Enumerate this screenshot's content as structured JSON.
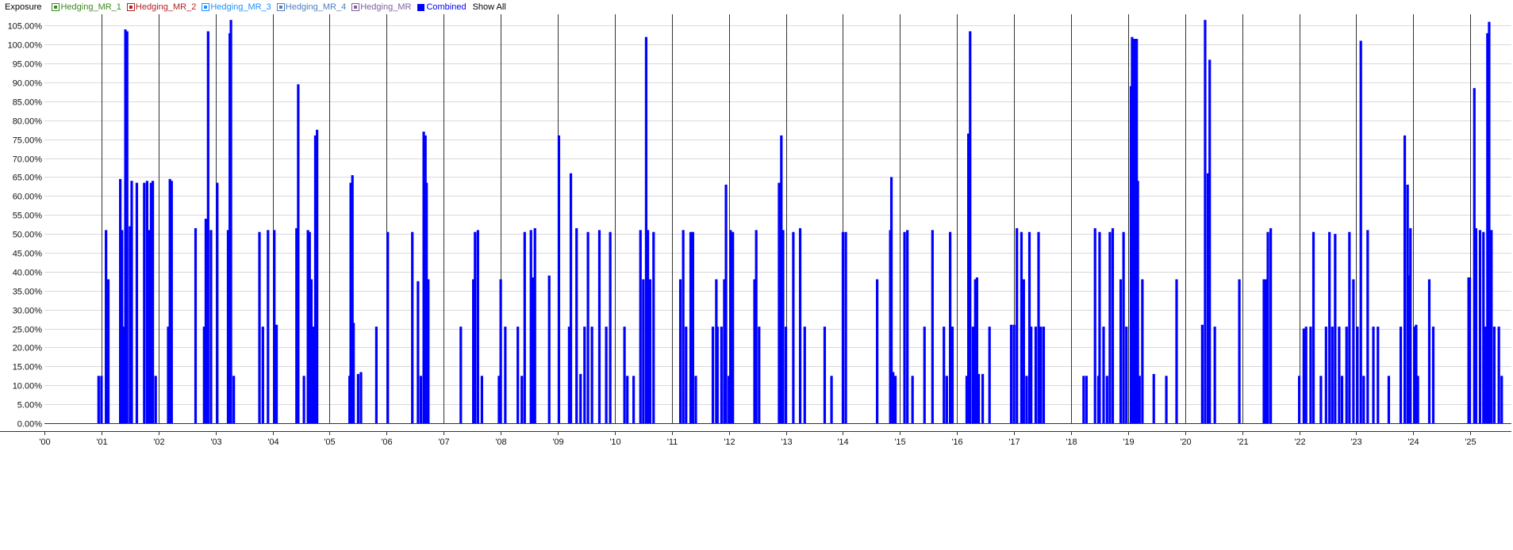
{
  "legend": {
    "title": "Exposure",
    "items": [
      {
        "label": "Hedging_MR_1",
        "color": "#3a8a1f",
        "icon": "checkbox-icon"
      },
      {
        "label": "Hedging_MR_2",
        "color": "#b22222",
        "icon": "checkbox-icon"
      },
      {
        "label": "Hedging_MR_3",
        "color": "#1e90ff",
        "icon": "checkbox-icon"
      },
      {
        "label": "Hedging_MR_4",
        "color": "#4f7fbf",
        "icon": "checkbox-icon"
      },
      {
        "label": "Hedging_MR",
        "color": "#8060a0",
        "icon": "checkbox-icon"
      },
      {
        "label": "Combined",
        "color": "#0000ff",
        "icon": "checkbox-icon",
        "filled": true
      }
    ],
    "show_all": "Show All"
  },
  "chart_data": {
    "type": "bar",
    "series": [
      {
        "name": "Combined",
        "color": "#0000ff"
      }
    ],
    "y_ticks": [
      "0.00%",
      "5.00%",
      "10.00%",
      "15.00%",
      "20.00%",
      "25.00%",
      "30.00%",
      "35.00%",
      "40.00%",
      "45.00%",
      "50.00%",
      "55.00%",
      "60.00%",
      "65.00%",
      "70.00%",
      "75.00%",
      "80.00%",
      "85.00%",
      "90.00%",
      "95.00%",
      "100.00%",
      "105.00%"
    ],
    "x_ticks": [
      "'00",
      "'01",
      "'02",
      "'03",
      "'04",
      "'05",
      "'06",
      "'07",
      "'08",
      "'09",
      "'10",
      "'11",
      "'12",
      "'13",
      "'14",
      "'15",
      "'16",
      "'17",
      "'18",
      "'19",
      "'20",
      "'21",
      "'22",
      "'23",
      "'24",
      "'25"
    ],
    "ylim": [
      0,
      108
    ],
    "xlim": [
      2000.0,
      2025.72
    ],
    "grid": true,
    "bars": [
      [
        2000.95,
        12.5
      ],
      [
        2001.0,
        12.5
      ],
      [
        2001.08,
        51
      ],
      [
        2001.12,
        38
      ],
      [
        2001.33,
        64.5
      ],
      [
        2001.36,
        51
      ],
      [
        2001.4,
        25.5
      ],
      [
        2001.42,
        104
      ],
      [
        2001.45,
        103.5
      ],
      [
        2001.5,
        52
      ],
      [
        2001.53,
        64
      ],
      [
        2001.62,
        63.5
      ],
      [
        2001.75,
        63.5
      ],
      [
        2001.8,
        64
      ],
      [
        2001.83,
        51
      ],
      [
        2001.87,
        63.5
      ],
      [
        2001.9,
        64
      ],
      [
        2001.95,
        12.5
      ],
      [
        2002.17,
        25.5
      ],
      [
        2002.2,
        64.5
      ],
      [
        2002.23,
        64
      ],
      [
        2002.65,
        51.5
      ],
      [
        2002.8,
        25.5
      ],
      [
        2002.83,
        54
      ],
      [
        2002.87,
        103.5
      ],
      [
        2002.92,
        51
      ],
      [
        2003.03,
        63.5
      ],
      [
        2003.22,
        51
      ],
      [
        2003.25,
        103
      ],
      [
        2003.27,
        106.5
      ],
      [
        2003.32,
        12.5
      ],
      [
        2003.77,
        50.5
      ],
      [
        2003.83,
        25.5
      ],
      [
        2003.92,
        51
      ],
      [
        2004.03,
        51
      ],
      [
        2004.07,
        26
      ],
      [
        2004.42,
        51.5
      ],
      [
        2004.45,
        89.5
      ],
      [
        2004.55,
        12.5
      ],
      [
        2004.62,
        51
      ],
      [
        2004.65,
        50.5
      ],
      [
        2004.68,
        38
      ],
      [
        2004.72,
        25.5
      ],
      [
        2004.75,
        76
      ],
      [
        2004.78,
        77.5
      ],
      [
        2005.35,
        12.5
      ],
      [
        2005.37,
        63.5
      ],
      [
        2005.4,
        65.5
      ],
      [
        2005.42,
        26.5
      ],
      [
        2005.5,
        13
      ],
      [
        2005.55,
        13.5
      ],
      [
        2005.82,
        25.5
      ],
      [
        2006.02,
        50.5
      ],
      [
        2006.45,
        50.5
      ],
      [
        2006.55,
        37.5
      ],
      [
        2006.6,
        12.5
      ],
      [
        2006.65,
        77
      ],
      [
        2006.68,
        76
      ],
      [
        2006.7,
        63.5
      ],
      [
        2006.73,
        38
      ],
      [
        2007.3,
        25.5
      ],
      [
        2007.52,
        38
      ],
      [
        2007.55,
        50.5
      ],
      [
        2007.6,
        51
      ],
      [
        2007.67,
        12.5
      ],
      [
        2007.97,
        12.5
      ],
      [
        2008.0,
        38
      ],
      [
        2008.08,
        25.5
      ],
      [
        2008.3,
        25.5
      ],
      [
        2008.37,
        12.5
      ],
      [
        2008.42,
        50.5
      ],
      [
        2008.53,
        51
      ],
      [
        2008.57,
        38.5
      ],
      [
        2008.6,
        51.5
      ],
      [
        2008.85,
        39
      ],
      [
        2009.02,
        76
      ],
      [
        2009.2,
        25.5
      ],
      [
        2009.23,
        66
      ],
      [
        2009.33,
        51.5
      ],
      [
        2009.4,
        13
      ],
      [
        2009.47,
        25.5
      ],
      [
        2009.53,
        50.5
      ],
      [
        2009.6,
        25.5
      ],
      [
        2009.73,
        51
      ],
      [
        2009.85,
        25.5
      ],
      [
        2009.92,
        50.5
      ],
      [
        2010.17,
        25.5
      ],
      [
        2010.22,
        12.5
      ],
      [
        2010.33,
        12.5
      ],
      [
        2010.45,
        51
      ],
      [
        2010.5,
        38
      ],
      [
        2010.55,
        102
      ],
      [
        2010.58,
        51
      ],
      [
        2010.62,
        38
      ],
      [
        2010.68,
        50.5
      ],
      [
        2011.15,
        38
      ],
      [
        2011.2,
        51
      ],
      [
        2011.25,
        25.5
      ],
      [
        2011.33,
        50.5
      ],
      [
        2011.37,
        50.5
      ],
      [
        2011.42,
        12.5
      ],
      [
        2011.72,
        25.5
      ],
      [
        2011.78,
        38
      ],
      [
        2011.8,
        25.5
      ],
      [
        2011.87,
        25.5
      ],
      [
        2011.92,
        38
      ],
      [
        2011.95,
        63
      ],
      [
        2012.0,
        12.5
      ],
      [
        2012.03,
        51
      ],
      [
        2012.07,
        50.5
      ],
      [
        2012.45,
        38
      ],
      [
        2012.48,
        51
      ],
      [
        2012.53,
        25.5
      ],
      [
        2012.88,
        63.5
      ],
      [
        2012.92,
        76
      ],
      [
        2012.95,
        51
      ],
      [
        2013.0,
        25.5
      ],
      [
        2013.13,
        50.5
      ],
      [
        2013.25,
        51.5
      ],
      [
        2013.33,
        25.5
      ],
      [
        2013.68,
        25.5
      ],
      [
        2013.8,
        12.5
      ],
      [
        2014.0,
        50.5
      ],
      [
        2014.05,
        50.5
      ],
      [
        2014.6,
        38
      ],
      [
        2014.83,
        51
      ],
      [
        2014.85,
        65
      ],
      [
        2014.88,
        13.5
      ],
      [
        2014.92,
        12.5
      ],
      [
        2015.08,
        50.5
      ],
      [
        2015.13,
        51
      ],
      [
        2015.22,
        12.5
      ],
      [
        2015.43,
        25.5
      ],
      [
        2015.57,
        51
      ],
      [
        2015.77,
        25.5
      ],
      [
        2015.82,
        12.5
      ],
      [
        2015.88,
        50.5
      ],
      [
        2015.92,
        25.5
      ],
      [
        2016.17,
        12.5
      ],
      [
        2016.2,
        76.5
      ],
      [
        2016.23,
        103.5
      ],
      [
        2016.28,
        25.5
      ],
      [
        2016.32,
        38
      ],
      [
        2016.35,
        38.5
      ],
      [
        2016.38,
        13
      ],
      [
        2016.45,
        13
      ],
      [
        2016.57,
        25.5
      ],
      [
        2016.95,
        26
      ],
      [
        2017.0,
        26
      ],
      [
        2017.05,
        51.5
      ],
      [
        2017.13,
        50.5
      ],
      [
        2017.17,
        38
      ],
      [
        2017.22,
        12.5
      ],
      [
        2017.27,
        50.5
      ],
      [
        2017.3,
        25.5
      ],
      [
        2017.38,
        25.5
      ],
      [
        2017.43,
        50.5
      ],
      [
        2017.47,
        25.5
      ],
      [
        2017.52,
        25.5
      ],
      [
        2018.22,
        12.5
      ],
      [
        2018.27,
        12.5
      ],
      [
        2018.42,
        51.5
      ],
      [
        2018.48,
        12.5
      ],
      [
        2018.5,
        50.5
      ],
      [
        2018.57,
        25.5
      ],
      [
        2018.63,
        12.5
      ],
      [
        2018.68,
        50.5
      ],
      [
        2018.73,
        51.5
      ],
      [
        2018.87,
        38
      ],
      [
        2018.92,
        50.5
      ],
      [
        2018.97,
        25.5
      ],
      [
        2019.05,
        89
      ],
      [
        2019.07,
        102
      ],
      [
        2019.1,
        101.5
      ],
      [
        2019.13,
        101.5
      ],
      [
        2019.15,
        101.5
      ],
      [
        2019.17,
        64
      ],
      [
        2019.2,
        12.5
      ],
      [
        2019.25,
        38
      ],
      [
        2019.45,
        13
      ],
      [
        2019.67,
        12.5
      ],
      [
        2019.85,
        38
      ],
      [
        2020.3,
        26
      ],
      [
        2020.35,
        106.5
      ],
      [
        2020.4,
        66
      ],
      [
        2020.43,
        96
      ],
      [
        2020.52,
        25.5
      ],
      [
        2020.95,
        38
      ],
      [
        2021.38,
        38
      ],
      [
        2021.42,
        38
      ],
      [
        2021.45,
        50.5
      ],
      [
        2021.5,
        51.5
      ],
      [
        2022.0,
        12.5
      ],
      [
        2022.08,
        25
      ],
      [
        2022.12,
        25.5
      ],
      [
        2022.2,
        25.5
      ],
      [
        2022.25,
        50.5
      ],
      [
        2022.38,
        12.5
      ],
      [
        2022.47,
        25.5
      ],
      [
        2022.53,
        50.5
      ],
      [
        2022.58,
        25.5
      ],
      [
        2022.63,
        50
      ],
      [
        2022.7,
        25.5
      ],
      [
        2022.75,
        12.5
      ],
      [
        2022.83,
        25.5
      ],
      [
        2022.88,
        50.5
      ],
      [
        2022.95,
        38
      ],
      [
        2023.02,
        25.5
      ],
      [
        2023.08,
        101
      ],
      [
        2023.13,
        12.5
      ],
      [
        2023.2,
        51
      ],
      [
        2023.3,
        25.5
      ],
      [
        2023.38,
        25.5
      ],
      [
        2023.57,
        12.5
      ],
      [
        2023.78,
        25.5
      ],
      [
        2023.85,
        76
      ],
      [
        2023.9,
        63
      ],
      [
        2023.92,
        39
      ],
      [
        2023.95,
        51.5
      ],
      [
        2024.02,
        25.5
      ],
      [
        2024.05,
        26
      ],
      [
        2024.08,
        12.5
      ],
      [
        2024.28,
        38
      ],
      [
        2024.35,
        25.5
      ],
      [
        2024.97,
        38.5
      ],
      [
        2024.99,
        38.5
      ],
      [
        2025.07,
        88.5
      ],
      [
        2025.1,
        51.5
      ],
      [
        2025.17,
        51
      ],
      [
        2025.23,
        50.5
      ],
      [
        2025.27,
        25.5
      ],
      [
        2025.3,
        103
      ],
      [
        2025.33,
        106
      ],
      [
        2025.37,
        51
      ],
      [
        2025.42,
        25.5
      ],
      [
        2025.5,
        25.5
      ],
      [
        2025.55,
        12.5
      ]
    ]
  }
}
